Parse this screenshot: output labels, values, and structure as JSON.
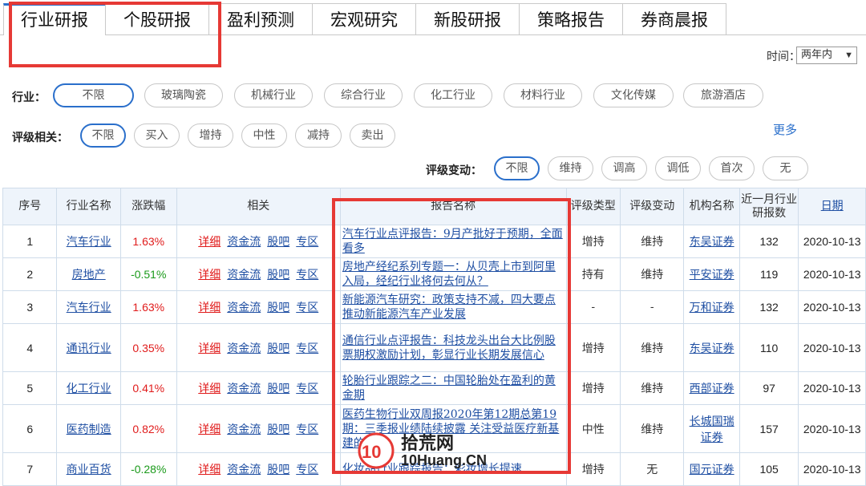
{
  "tabs": [
    "行业研报",
    "个股研报",
    "盈利预测",
    "宏观研究",
    "新股研报",
    "策略报告",
    "券商晨报"
  ],
  "time": {
    "label": "时间：",
    "value": "两年内"
  },
  "industry_filter": {
    "label": "行业：",
    "options": [
      "不限",
      "玻璃陶瓷",
      "机械行业",
      "综合行业",
      "化工行业",
      "材料行业",
      "文化传媒",
      "旅游酒店"
    ]
  },
  "rating_filter": {
    "label": "评级相关：",
    "options": [
      "不限",
      "买入",
      "增持",
      "中性",
      "减持",
      "卖出"
    ]
  },
  "more": "更多",
  "change_filter": {
    "label": "评级变动：",
    "options": [
      "不限",
      "维持",
      "调高",
      "调低",
      "首次",
      "无"
    ]
  },
  "table": {
    "headers": [
      "序号",
      "行业名称",
      "涨跌幅",
      "相关",
      "报告名称",
      "评级类型",
      "评级变动",
      "机构名称",
      "近一月行业研报数",
      "日期"
    ],
    "link_labels": [
      "详细",
      "资金流",
      "股吧",
      "专区"
    ],
    "rows": [
      {
        "idx": "1",
        "industry": "汽车行业",
        "change": "1.63%",
        "title": "汽车行业点评报告：9月产批好于预期，全面看多",
        "rating": "增持",
        "rating_change": "维持",
        "org": "东吴证券",
        "count": "132",
        "date": "2020-10-13"
      },
      {
        "idx": "2",
        "industry": "房地产",
        "change": "-0.51%",
        "title": "房地产经纪系列专题一：从贝壳上市到阿里入局，经纪行业将何去何从？",
        "rating": "持有",
        "rating_change": "维持",
        "org": "平安证券",
        "count": "119",
        "date": "2020-10-13"
      },
      {
        "idx": "3",
        "industry": "汽车行业",
        "change": "1.63%",
        "title": "新能源汽车研究：政策支持不减，四大要点推动新能源汽车产业发展",
        "rating": "-",
        "rating_change": "-",
        "org": "万和证券",
        "count": "132",
        "date": "2020-10-13"
      },
      {
        "idx": "4",
        "industry": "通讯行业",
        "change": "0.35%",
        "title": "通信行业点评报告：科技龙头出台大比例股票期权激励计划，彰显行业长期发展信心",
        "rating": "增持",
        "rating_change": "维持",
        "org": "东吴证券",
        "count": "110",
        "date": "2020-10-13"
      },
      {
        "idx": "5",
        "industry": "化工行业",
        "change": "0.41%",
        "title": "轮胎行业跟踪之二：中国轮胎处在盈利的黄金期",
        "rating": "增持",
        "rating_change": "维持",
        "org": "西部证券",
        "count": "97",
        "date": "2020-10-13"
      },
      {
        "idx": "6",
        "industry": "医药制造",
        "change": "0.82%",
        "title": "医药生物行业双周报2020年第12期总第19期：三季报业绩陆续披露 关注受益医疗新基建的板块",
        "rating": "中性",
        "rating_change": "维持",
        "org": "长城国瑞证券",
        "count": "157",
        "date": "2020-10-13"
      },
      {
        "idx": "7",
        "industry": "商业百货",
        "change": "-0.28%",
        "title": "化妆品行业跟踪报告：彩妆增长提速",
        "rating": "增持",
        "rating_change": "无",
        "org": "国元证券",
        "count": "105",
        "date": "2020-10-13"
      }
    ]
  },
  "watermark": {
    "cn": "拾荒网",
    "domain": "10Huang.CN"
  },
  "colors": {
    "accent": "#2a6fcb",
    "highlight": "#e63935",
    "up": "#e01b1b",
    "down": "#1a9a1a"
  }
}
